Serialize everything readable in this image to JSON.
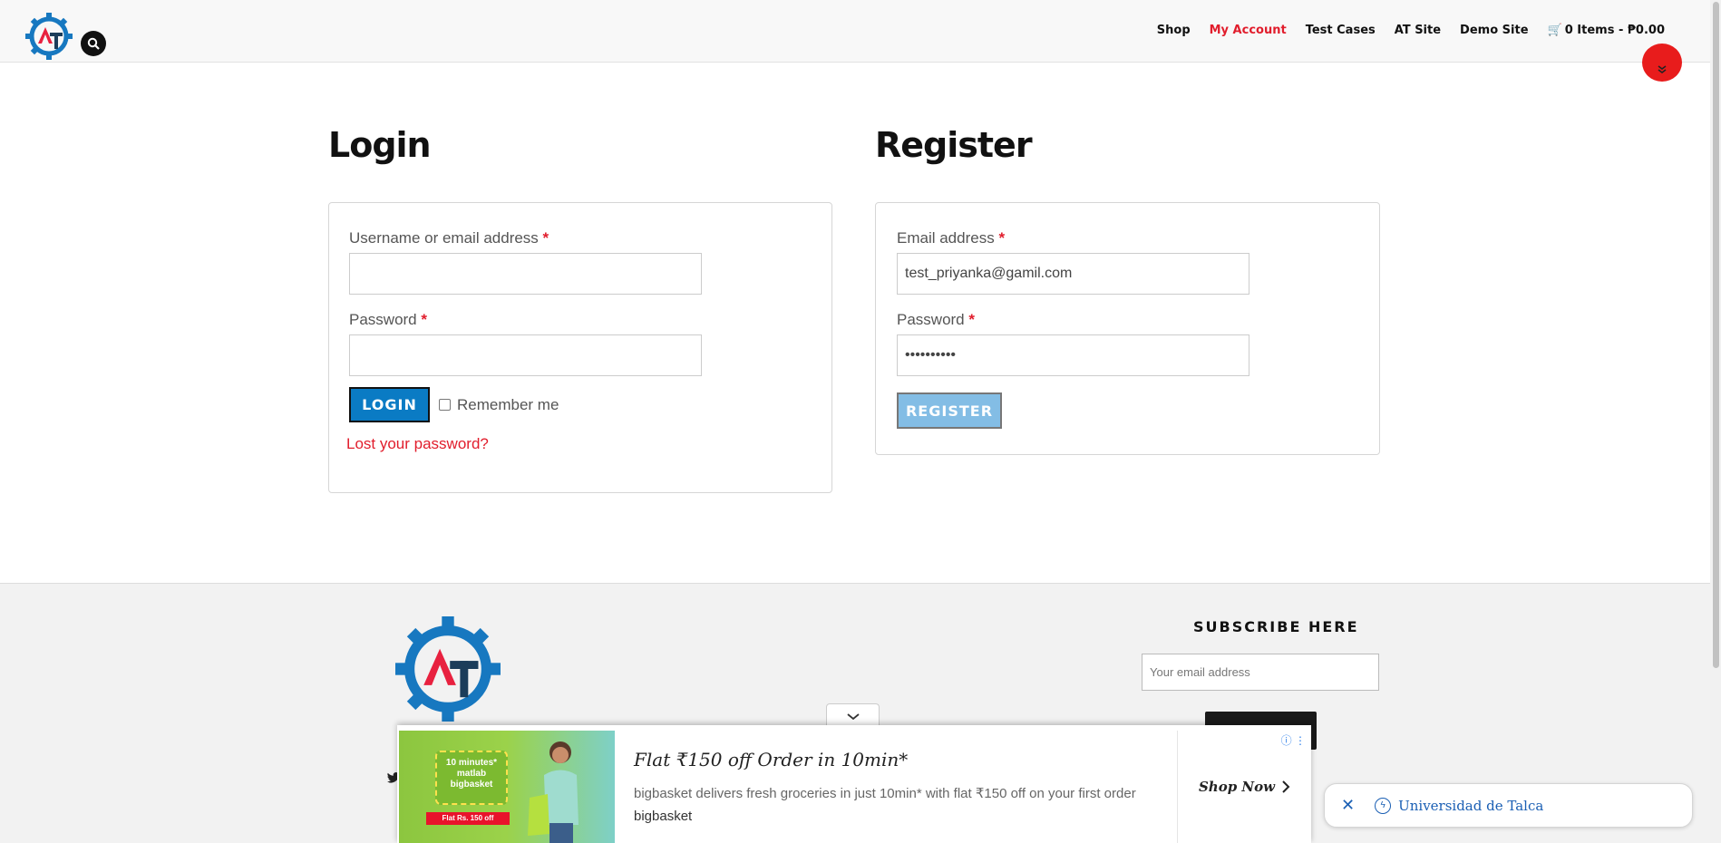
{
  "header": {
    "nav": [
      {
        "label": "Shop",
        "active": false
      },
      {
        "label": "My Account",
        "active": true
      },
      {
        "label": "Test Cases",
        "active": false
      },
      {
        "label": "AT Site",
        "active": false
      },
      {
        "label": "Demo Site",
        "active": false
      }
    ],
    "cart": "0 Items - ₱0.00"
  },
  "login": {
    "title": "Login",
    "username_label": "Username or email address",
    "username_value": "",
    "password_label": "Password",
    "password_value": "",
    "required_mark": "*",
    "login_button": "LOGIN",
    "remember_me": "Remember me",
    "lost_password": "Lost your password?"
  },
  "register": {
    "title": "Register",
    "email_label": "Email address",
    "email_value": "test_priyanka@gamil.com",
    "password_label": "Password",
    "password_value": "••••••••••",
    "required_mark": "*",
    "register_button": "REGISTER"
  },
  "footer": {
    "subscribe_title": "SUBSCRIBE HERE",
    "subscribe_placeholder": "Your email address"
  },
  "ad": {
    "headline": "Flat ₹150 off Order in 10min*",
    "description": "bigbasket delivers fresh groceries in just 10min* with flat ₹150 off on your first order",
    "brand": "bigbasket",
    "cta": "Shop Now",
    "image_box_text": "10 minutes* matlab bigbasket",
    "image_badge": "Flat Rs. 150 off"
  },
  "notification": {
    "text": "Universidad de Talca"
  },
  "colors": {
    "accent_red": "#e11d2c",
    "login_blue": "#0a7bc4",
    "register_blue": "#83bde5"
  }
}
